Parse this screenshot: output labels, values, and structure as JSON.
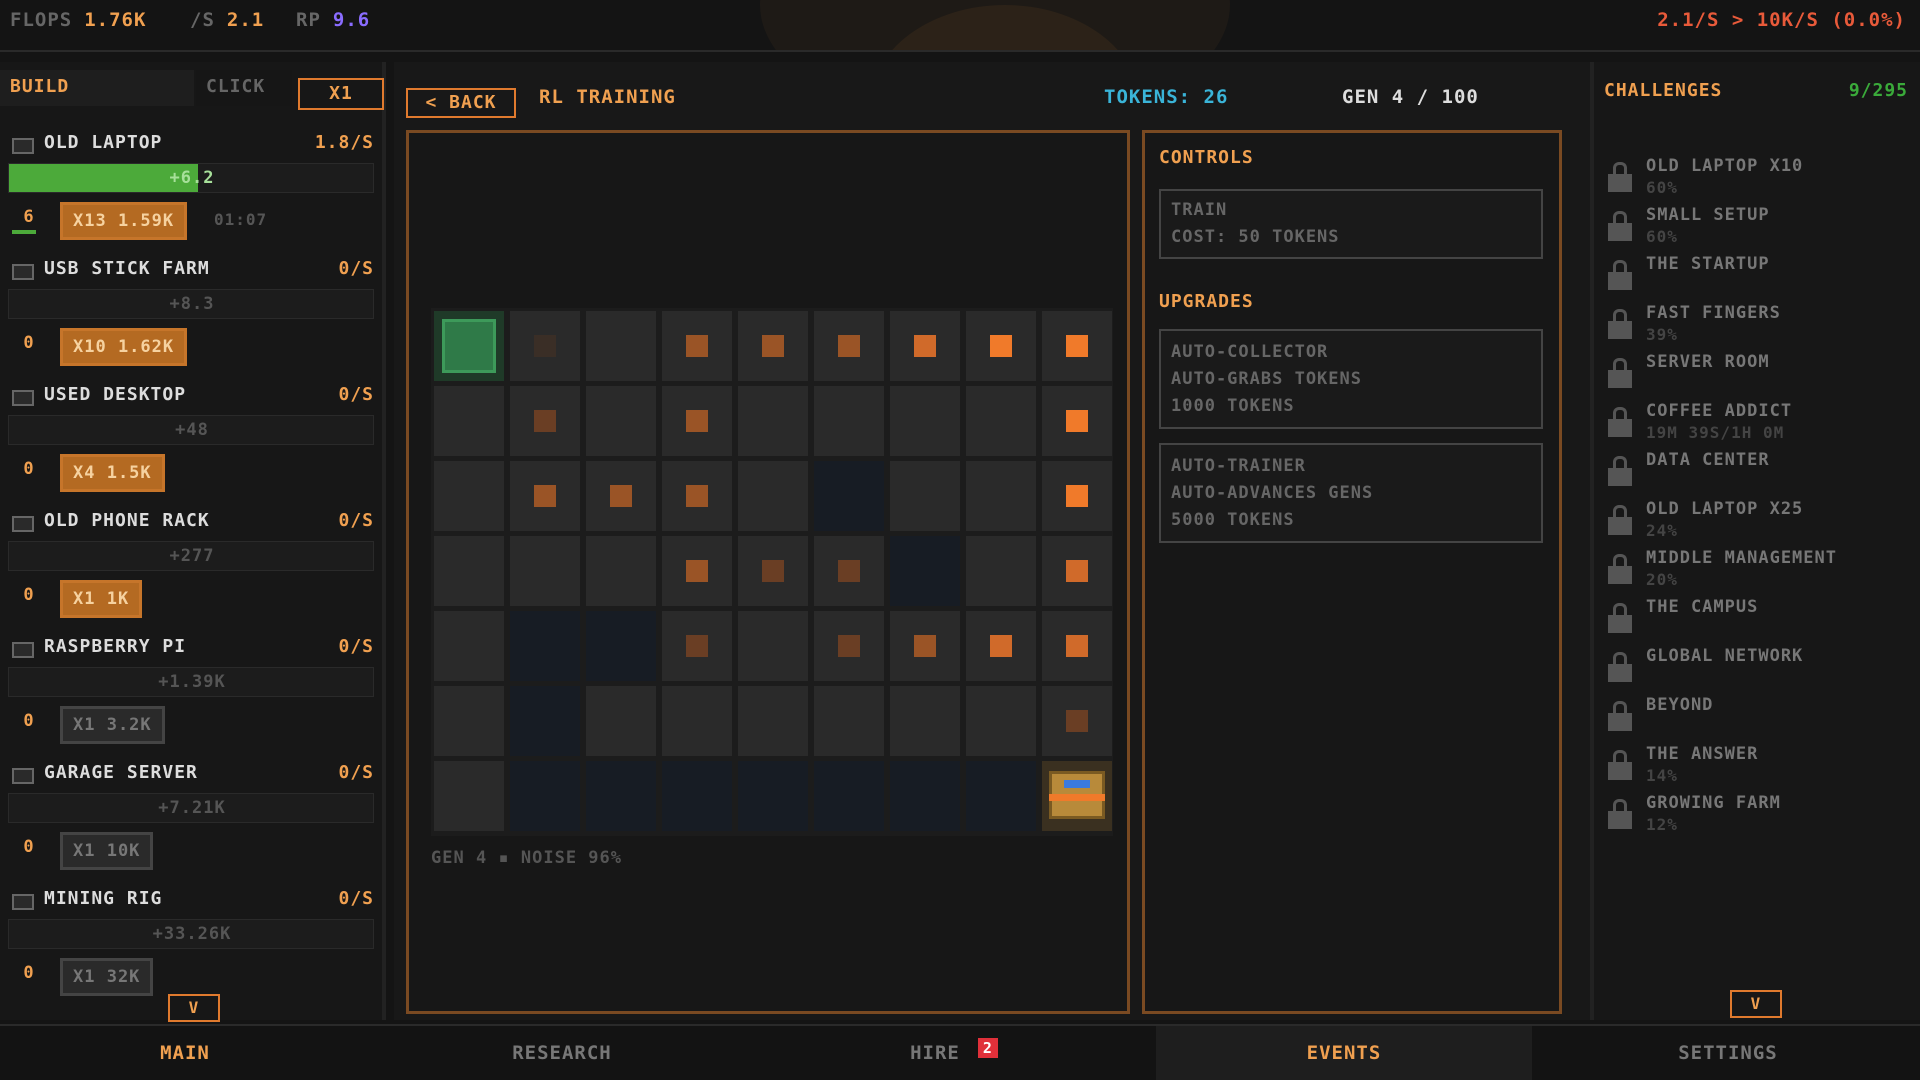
{
  "topbar": {
    "flops_label": "FLOPS",
    "flops_value": "1.76K",
    "per_sec_label": "/S",
    "per_sec_value": "2.1",
    "rp_label": "RP",
    "rp_value": "9.6",
    "rate_summary": "2.1/S > 10K/S (0.0%)"
  },
  "left": {
    "tabs": {
      "build": "BUILD",
      "click": "CLICK",
      "multiplier": "X1"
    },
    "items": [
      {
        "name": "OLD LAPTOP",
        "rate": "1.8/S",
        "gain": "+6.2",
        "progress": 0.52,
        "count": "6",
        "buy": "X13 1.59K",
        "timer": "01:07",
        "affordable": true
      },
      {
        "name": "USB STICK FARM",
        "rate": "0/S",
        "gain": "+8.3",
        "progress": 0,
        "count": "0",
        "buy": "X10 1.62K",
        "timer": "",
        "affordable": true
      },
      {
        "name": "USED DESKTOP",
        "rate": "0/S",
        "gain": "+48",
        "progress": 0,
        "count": "0",
        "buy": "X4 1.5K",
        "timer": "",
        "affordable": true
      },
      {
        "name": "OLD PHONE RACK",
        "rate": "0/S",
        "gain": "+277",
        "progress": 0,
        "count": "0",
        "buy": "X1 1K",
        "timer": "",
        "affordable": true
      },
      {
        "name": "RASPBERRY PI",
        "rate": "0/S",
        "gain": "+1.39K",
        "progress": 0,
        "count": "0",
        "buy": "X1 3.2K",
        "timer": "",
        "affordable": false
      },
      {
        "name": "GARAGE SERVER",
        "rate": "0/S",
        "gain": "+7.21K",
        "progress": 0,
        "count": "0",
        "buy": "X1 10K",
        "timer": "",
        "affordable": false
      },
      {
        "name": "MINING RIG",
        "rate": "0/S",
        "gain": "+33.26K",
        "progress": 0,
        "count": "0",
        "buy": "X1 32K",
        "timer": "",
        "affordable": false
      }
    ],
    "more": "V"
  },
  "main": {
    "back": "< BACK",
    "title": "RL TRAINING",
    "tokens": "TOKENS: 26",
    "gen": "GEN 4 / 100",
    "status": "GEN 4 ▪ NOISE 96%",
    "grid": {
      "rows": 7,
      "cols": 9,
      "cells": [
        "agent",
        "d1",
        "e",
        "t3",
        "t3",
        "t3",
        "t4",
        "t5",
        "t5",
        "e",
        "t2",
        "e",
        "t3",
        "e",
        "e",
        "e",
        "e",
        "t5",
        "e",
        "t3",
        "t3",
        "t3",
        "e",
        "k",
        "e",
        "e",
        "t5",
        "e",
        "e",
        "e",
        "t3",
        "t2",
        "t2",
        "k",
        "e",
        "t4",
        "e",
        "k",
        "k",
        "t2",
        "e",
        "t2",
        "t3",
        "t4",
        "t4",
        "e",
        "k",
        "e",
        "e",
        "e",
        "e",
        "e",
        "e",
        "t2",
        "e",
        "k",
        "k",
        "k",
        "k",
        "k",
        "k",
        "k",
        "goal"
      ]
    }
  },
  "controls": {
    "title": "CONTROLS",
    "train_label": "TRAIN",
    "train_cost": "COST: 50 TOKENS",
    "upgrades_title": "UPGRADES",
    "upgrades": [
      {
        "name": "AUTO-COLLECTOR",
        "desc": "AUTO-GRABS TOKENS",
        "cost": "1000 TOKENS"
      },
      {
        "name": "AUTO-TRAINER",
        "desc": "AUTO-ADVANCES GENS",
        "cost": "5000 TOKENS"
      }
    ]
  },
  "challenges": {
    "title": "CHALLENGES",
    "count": "9/295",
    "items": [
      {
        "name": "OLD LAPTOP X10",
        "progress": "60%"
      },
      {
        "name": "SMALL SETUP",
        "progress": "60%"
      },
      {
        "name": "THE STARTUP",
        "progress": ""
      },
      {
        "name": "FAST FINGERS",
        "progress": "39%"
      },
      {
        "name": "SERVER ROOM",
        "progress": ""
      },
      {
        "name": "COFFEE ADDICT",
        "progress": "19M 39S/1H 0M"
      },
      {
        "name": "DATA CENTER",
        "progress": ""
      },
      {
        "name": "OLD LAPTOP X25",
        "progress": "24%"
      },
      {
        "name": "MIDDLE MANAGEMENT",
        "progress": "20%"
      },
      {
        "name": "THE CAMPUS",
        "progress": ""
      },
      {
        "name": "GLOBAL NETWORK",
        "progress": ""
      },
      {
        "name": "BEYOND",
        "progress": ""
      },
      {
        "name": "THE ANSWER",
        "progress": "14%"
      },
      {
        "name": "GROWING FARM",
        "progress": "12%"
      }
    ],
    "more": "V"
  },
  "nav": {
    "tabs": [
      {
        "label": "MAIN"
      },
      {
        "label": "RESEARCH"
      },
      {
        "label": "HIRE",
        "badge": "2"
      },
      {
        "label": "EVENTS"
      },
      {
        "label": "SETTINGS"
      }
    ]
  },
  "colors": {
    "accent": "#f0a050",
    "token": "#3ab4d8",
    "green": "#4caa3a",
    "red_badge": "#e0303a"
  }
}
